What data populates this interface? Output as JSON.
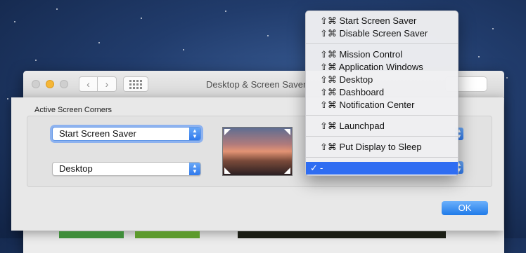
{
  "window": {
    "title": "Desktop & Screen Saver",
    "back_icon": "‹",
    "forward_icon": "›"
  },
  "sheet": {
    "label": "Active Screen Corners",
    "top_left": "Start Screen Saver",
    "bottom_left": "Desktop",
    "ok_label": "OK"
  },
  "menu": {
    "items": [
      "⇧⌘ Start Screen Saver",
      "⇧⌘ Disable Screen Saver",
      "⇧⌘ Mission Control",
      "⇧⌘ Application Windows",
      "⇧⌘ Desktop",
      "⇧⌘ Dashboard",
      "⇧⌘ Notification Center",
      "⇧⌘ Launchpad",
      "⇧⌘ Put Display to Sleep",
      "-"
    ],
    "selected_mark": "✓"
  },
  "colors": {
    "accent": "#2f6df2",
    "ok_button": "#1f7ae9"
  }
}
